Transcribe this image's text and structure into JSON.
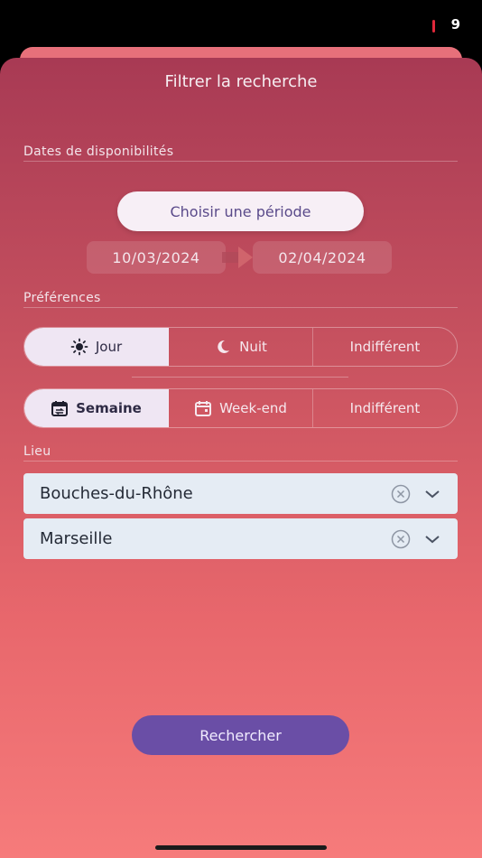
{
  "status_bar": {
    "battery_level": "9"
  },
  "sheet": {
    "title": "Filtrer la recherche"
  },
  "dates": {
    "section_label": "Dates de disponibilités",
    "period_button": "Choisir une période",
    "start_date": "10/03/2024",
    "end_date": "02/04/2024"
  },
  "preferences": {
    "section_label": "Préférences",
    "time_of_day": [
      {
        "label": "Jour",
        "icon": "sun-icon",
        "active": true
      },
      {
        "label": "Nuit",
        "icon": "moon-icon",
        "active": false
      },
      {
        "label": "Indifférent",
        "icon": "",
        "active": false
      }
    ],
    "week_part": [
      {
        "label": "Semaine",
        "icon": "calendar-repeat-icon",
        "active": true
      },
      {
        "label": "Week-end",
        "icon": "calendar-icon",
        "active": false
      },
      {
        "label": "Indifférent",
        "icon": "",
        "active": false
      }
    ]
  },
  "location": {
    "section_label": "Lieu",
    "department": "Bouches-du-Rhône",
    "city": "Marseille"
  },
  "search_button": "Rechercher",
  "colors": {
    "gradient_top": "#a83a54",
    "gradient_bottom": "#f67b7b",
    "active_segment": "#efe6f3",
    "search_button": "#6a4ea6",
    "period_text": "#5a4a8a",
    "field_bg": "#e5ecf4"
  }
}
